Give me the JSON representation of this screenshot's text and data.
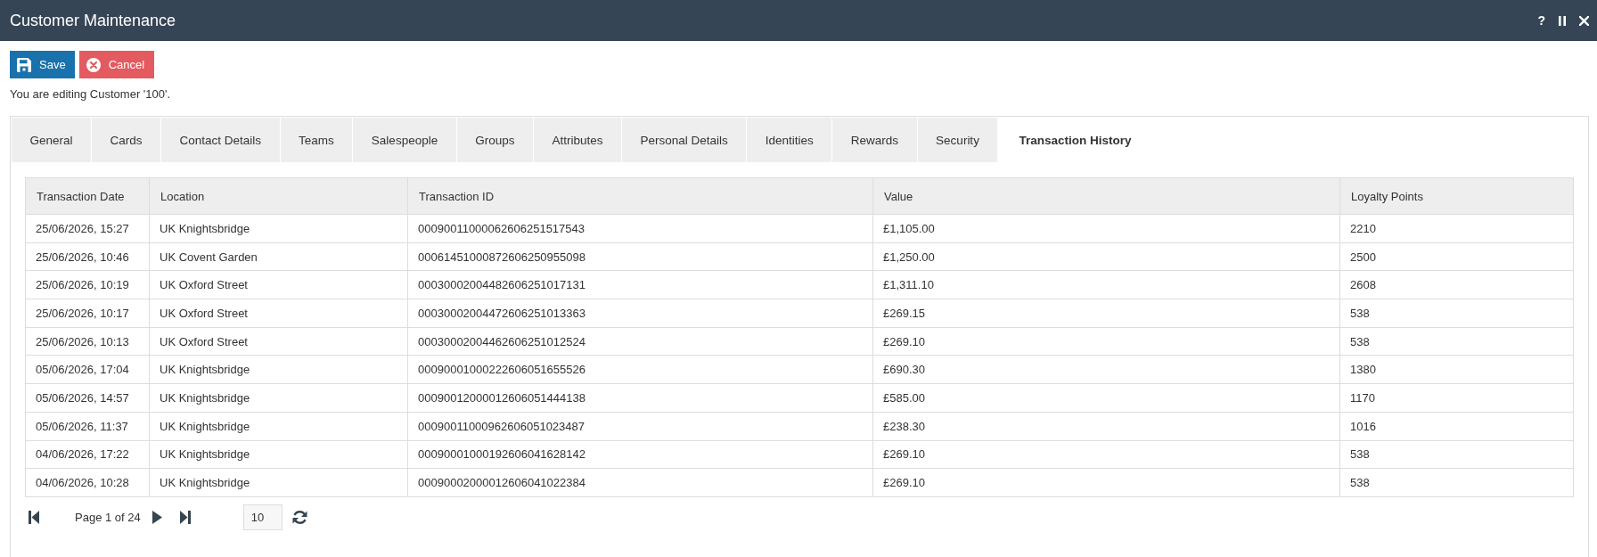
{
  "window": {
    "title": "Customer Maintenance",
    "help": "?"
  },
  "actions": [
    {
      "kind": "save",
      "label": "Save"
    },
    {
      "kind": "cancel",
      "label": "Cancel"
    }
  ],
  "message": "You are editing Customer '100'.",
  "tabs": [
    {
      "label": "General",
      "selected": false
    },
    {
      "label": "Cards",
      "selected": false
    },
    {
      "label": "Contact Details",
      "selected": false
    },
    {
      "label": "Teams",
      "selected": false
    },
    {
      "label": "Salespeople",
      "selected": false
    },
    {
      "label": "Groups",
      "selected": false
    },
    {
      "label": "Attributes",
      "selected": false
    },
    {
      "label": "Personal Details",
      "selected": false
    },
    {
      "label": "Identities",
      "selected": false
    },
    {
      "label": "Rewards",
      "selected": false
    },
    {
      "label": "Security",
      "selected": false
    },
    {
      "label": "Transaction History",
      "selected": true
    }
  ],
  "table": {
    "columns": [
      "Transaction Date",
      "Location",
      "Transaction ID",
      "Value",
      "Loyalty Points"
    ],
    "rows": [
      [
        "25/06/2026, 15:27",
        "UK Knightsbridge",
        "00090011000062606251517543",
        "£1,105.00",
        "2210"
      ],
      [
        "25/06/2026, 10:46",
        "UK Covent Garden",
        "00061451000872606250955098",
        "£1,250.00",
        "2500"
      ],
      [
        "25/06/2026, 10:19",
        "UK Oxford Street",
        "00030002004482606251017131",
        "£1,311.10",
        "2608"
      ],
      [
        "25/06/2026, 10:17",
        "UK Oxford Street",
        "00030002004472606251013363",
        "£269.15",
        "538"
      ],
      [
        "25/06/2026, 10:13",
        "UK Oxford Street",
        "00030002004462606251012524",
        "£269.10",
        "538"
      ],
      [
        "05/06/2026, 17:04",
        "UK Knightsbridge",
        "00090001000222606051655526",
        "£690.30",
        "1380"
      ],
      [
        "05/06/2026, 14:57",
        "UK Knightsbridge",
        "00090012000012606051444138",
        "£585.00",
        "1170"
      ],
      [
        "05/06/2026, 11:37",
        "UK Knightsbridge",
        "00090011000962606051023487",
        "£238.30",
        "1016"
      ],
      [
        "04/06/2026, 17:22",
        "UK Knightsbridge",
        "00090001000192606041628142",
        "£269.10",
        "538"
      ],
      [
        "04/06/2026, 10:28",
        "UK Knightsbridge",
        "00090002000012606041022384",
        "£269.10",
        "538"
      ]
    ]
  },
  "pager": {
    "page_info": "Page 1 of 24",
    "page_size": "10"
  }
}
